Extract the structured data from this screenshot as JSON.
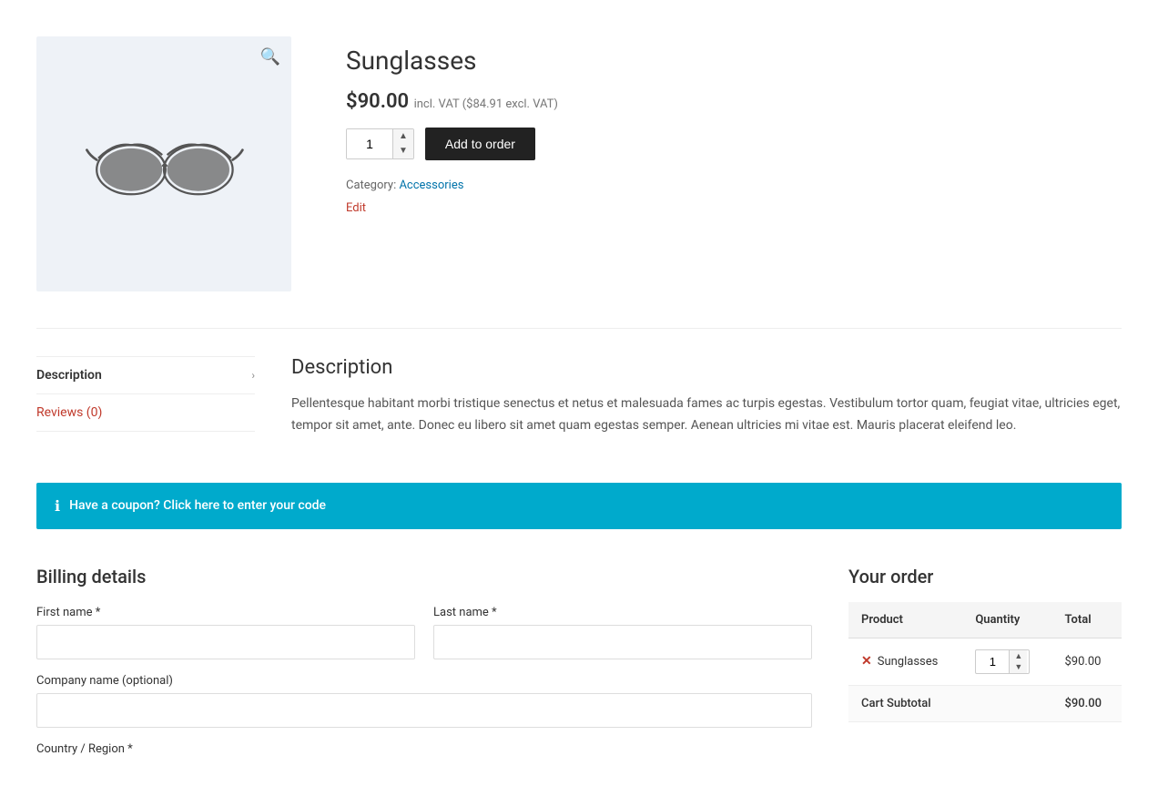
{
  "product": {
    "title": "Sunglasses",
    "price": "$90.00",
    "price_incl_vat": "incl. VAT",
    "price_excl_vat": "($84.91 excl. VAT)",
    "quantity": "1",
    "add_to_order_label": "Add to order",
    "category_label": "Category:",
    "category": "Accessories",
    "edit_label": "Edit"
  },
  "tabs": {
    "description_label": "Description",
    "reviews_label": "Reviews (0)",
    "description_content_title": "Description",
    "description_content": "Pellentesque habitant morbi tristique senectus et netus et malesuada fames ac turpis egestas. Vestibulum tortor quam, feugiat vitae, ultricies eget, tempor sit amet, ante. Donec eu libero sit amet quam egestas semper. Aenean ultricies mi vitae est. Mauris placerat eleifend leo."
  },
  "coupon": {
    "text": "Have a coupon? Click here to enter your code"
  },
  "billing": {
    "title": "Billing details",
    "first_name_label": "First name",
    "first_name_required": " *",
    "last_name_label": "Last name",
    "last_name_required": " *",
    "company_name_label": "Company name (optional)",
    "country_label": "Country / Region",
    "country_required": " *"
  },
  "your_order": {
    "title": "Your order",
    "col_product": "Product",
    "col_quantity": "Quantity",
    "col_total": "Total",
    "item_name": "Sunglasses",
    "item_quantity": "1",
    "item_total": "$90.00",
    "cart_subtotal_label": "Cart Subtotal",
    "cart_subtotal_value": "$90.00"
  },
  "icons": {
    "zoom": "🔍",
    "info": "ℹ",
    "chevron_right": "›",
    "remove": "✕"
  }
}
